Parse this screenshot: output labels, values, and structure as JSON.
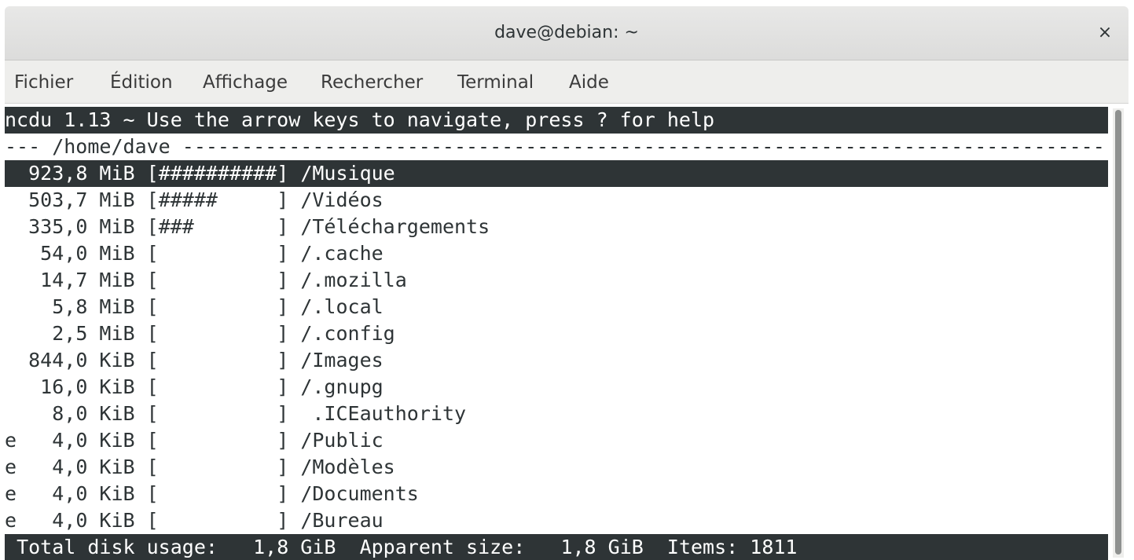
{
  "window": {
    "title": "dave@debian: ~",
    "close_glyph": "×"
  },
  "menu": [
    "Fichier",
    "Édition",
    "Affichage",
    "Rechercher",
    "Terminal",
    "Aide"
  ],
  "terminal": {
    "header": "ncdu 1.13 ~ Use the arrow keys to navigate, press ? for help",
    "path_line": "--- /home/dave ----------------------------------------------------------------------------------------------",
    "rows": [
      {
        "flag": " ",
        "size": "923,8 MiB",
        "bar": "##########",
        "name": "/Musique",
        "selected": true
      },
      {
        "flag": " ",
        "size": "503,7 MiB",
        "bar": "#####     ",
        "name": "/Vidéos",
        "selected": false
      },
      {
        "flag": " ",
        "size": "335,0 MiB",
        "bar": "###       ",
        "name": "/Téléchargements",
        "selected": false
      },
      {
        "flag": " ",
        "size": " 54,0 MiB",
        "bar": "          ",
        "name": "/.cache",
        "selected": false
      },
      {
        "flag": " ",
        "size": " 14,7 MiB",
        "bar": "          ",
        "name": "/.mozilla",
        "selected": false
      },
      {
        "flag": " ",
        "size": "  5,8 MiB",
        "bar": "          ",
        "name": "/.local",
        "selected": false
      },
      {
        "flag": " ",
        "size": "  2,5 MiB",
        "bar": "          ",
        "name": "/.config",
        "selected": false
      },
      {
        "flag": " ",
        "size": "844,0 KiB",
        "bar": "          ",
        "name": "/Images",
        "selected": false
      },
      {
        "flag": " ",
        "size": " 16,0 KiB",
        "bar": "          ",
        "name": "/.gnupg",
        "selected": false
      },
      {
        "flag": " ",
        "size": "  8,0 KiB",
        "bar": "          ",
        "name": " .ICEauthority",
        "selected": false
      },
      {
        "flag": "e",
        "size": "  4,0 KiB",
        "bar": "          ",
        "name": "/Public",
        "selected": false
      },
      {
        "flag": "e",
        "size": "  4,0 KiB",
        "bar": "          ",
        "name": "/Modèles",
        "selected": false
      },
      {
        "flag": "e",
        "size": "  4,0 KiB",
        "bar": "          ",
        "name": "/Documents",
        "selected": false
      },
      {
        "flag": "e",
        "size": "  4,0 KiB",
        "bar": "          ",
        "name": "/Bureau",
        "selected": false
      }
    ],
    "status": {
      "total_label": "Total disk usage:",
      "total_value": "1,8 GiB",
      "apparent_label": "Apparent size:",
      "apparent_value": "1,8 GiB",
      "items_label": "Items:",
      "items_value": "1811"
    }
  },
  "colors": {
    "fg": "#2e3436",
    "bg": "#ffffff",
    "inverse_bg": "#2e3436"
  }
}
